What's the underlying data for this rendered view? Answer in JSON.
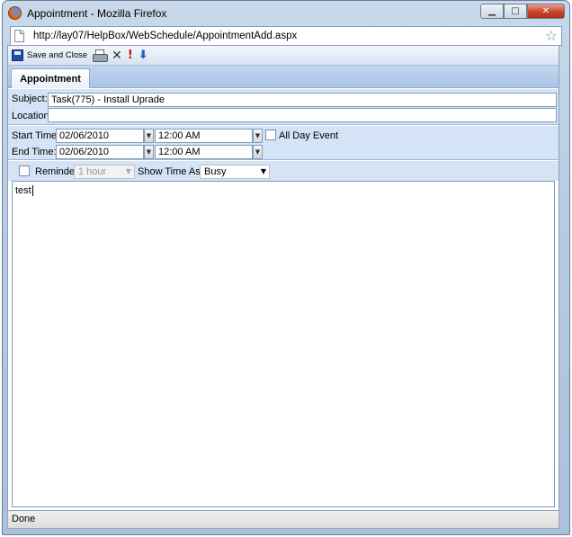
{
  "window": {
    "title": "Appointment - Mozilla Firefox",
    "url": "http://lay07/HelpBox/WebSchedule/AppointmentAdd.aspx",
    "status": "Done"
  },
  "icons": {
    "app": "firefox-icon",
    "page": "page-icon",
    "bookmark": "star-icon",
    "save": "floppy-disk-icon",
    "print": "printer-icon",
    "delete": "x-icon",
    "important": "exclamation-icon",
    "low": "down-arrow-icon",
    "minimize": "minimize-icon",
    "maximize": "maximize-icon",
    "close": "close-icon"
  },
  "toolbar": {
    "save_close_label": "Save and Close",
    "delete_glyph": "✕",
    "important_glyph": "!",
    "low_glyph": "⬇"
  },
  "tabs": [
    {
      "label": "Appointment",
      "active": true
    }
  ],
  "form": {
    "subject_label": "Subject:",
    "subject_value": "Task(775) - Install Uprade",
    "location_label": "Location:",
    "location_value": "",
    "start_label": "Start Time:",
    "start_date": "02/06/2010",
    "start_time": "12:00 AM",
    "end_label": "End Time:",
    "end_date": "02/06/2010",
    "end_time": "12:00 AM",
    "all_day_label": "All Day Event",
    "all_day_checked": false,
    "reminder_label": "Reminder",
    "reminder_checked": false,
    "reminder_value": "1 hour",
    "show_time_label": "Show Time As:",
    "show_time_value": "Busy",
    "notes": "test"
  },
  "colors": {
    "panel_bg": "#d4e3f5",
    "tab_strip": "#a9c4e6",
    "close_button": "#c8432c"
  }
}
